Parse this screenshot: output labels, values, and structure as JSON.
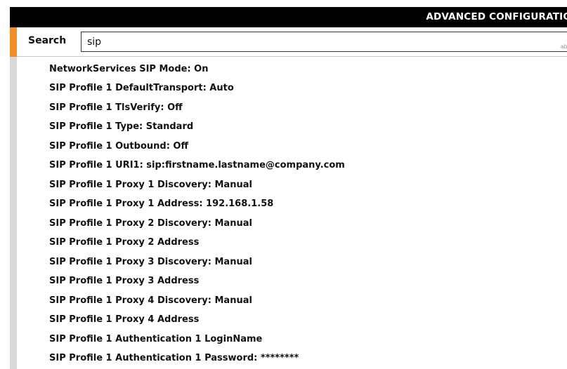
{
  "header": {
    "title": "ADVANCED CONFIGURATIO"
  },
  "search": {
    "label": "Search",
    "value": "sip",
    "keyboard_hint": "abc"
  },
  "results": [
    "NetworkServices SIP Mode: On",
    "SIP Profile 1 DefaultTransport: Auto",
    "SIP Profile 1 TlsVerify: Off",
    "SIP Profile 1 Type: Standard",
    "SIP Profile 1 Outbound: Off",
    "SIP Profile 1 URI1: sip:firstname.lastname@company.com",
    "SIP Profile 1 Proxy 1 Discovery: Manual",
    "SIP Profile 1 Proxy 1 Address: 192.168.1.58",
    "SIP Profile 1 Proxy 2 Discovery: Manual",
    "SIP Profile 1 Proxy 2 Address",
    "SIP Profile 1 Proxy 3 Discovery: Manual",
    "SIP Profile 1 Proxy 3 Address",
    "SIP Profile 1 Proxy 4 Discovery: Manual",
    "SIP Profile 1 Proxy 4 Address",
    "SIP Profile 1 Authentication 1 LoginName",
    "SIP Profile 1 Authentication 1 Password: ********"
  ],
  "colors": {
    "accent": "#f28c28",
    "title_bar": "#000000",
    "gutter": "#d9d9d9"
  }
}
